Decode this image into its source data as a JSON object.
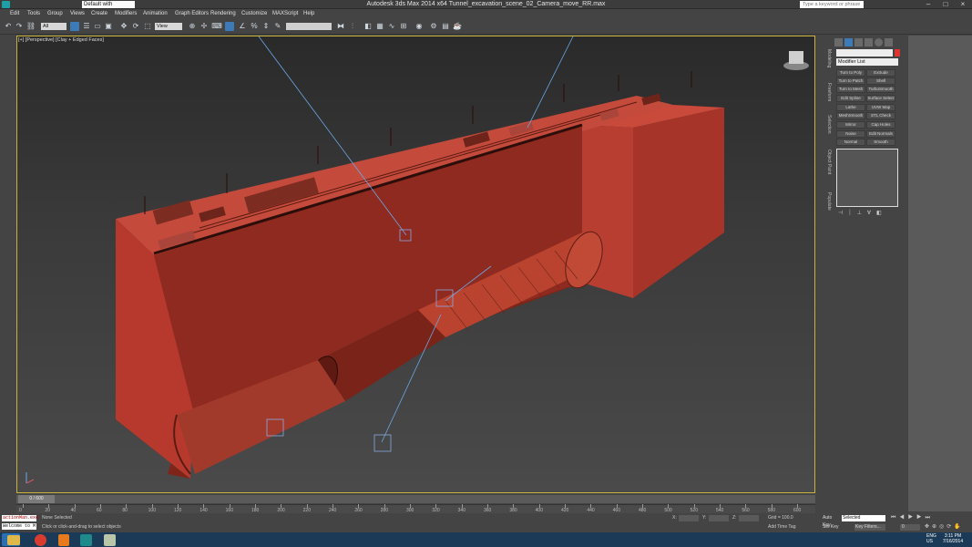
{
  "titlebar": {
    "workspace": "Default with Enhance",
    "title": "Autodesk 3ds Max  2014 x64     Tunnel_excavation_scene_02_Camera_move_RR.max",
    "search_placeholder": "Type a keyword or phrase"
  },
  "menu": [
    "Edit",
    "Tools",
    "Group",
    "Views",
    "Create",
    "Modifiers",
    "Animation",
    "Graph Editors",
    "Rendering",
    "Customize",
    "MAXScript",
    "Help"
  ],
  "toolbar": {
    "selection_filter": "All",
    "ref_coord": "View"
  },
  "viewport": {
    "label": "[+] [Perspective] [Clay + Edged Faces]"
  },
  "command_panel": {
    "tabs": [
      "Modeling",
      "Freeform",
      "Selection",
      "Object Paint",
      "Populate"
    ],
    "modifier_list": "Modifier List",
    "buttons": [
      [
        "Turn to Poly",
        "Extrude"
      ],
      [
        "Turn to Patch",
        "Shell"
      ],
      [
        "Turn to Mesh",
        "TurboSmooth"
      ],
      [
        "Edit Spline",
        "Surface Select"
      ],
      [
        "Lathe",
        "UVW Map"
      ],
      [
        "MeshSmooth",
        "STL Check"
      ],
      [
        "Mirror",
        "Cap Holes"
      ],
      [
        "Noise",
        "Edit Normals"
      ],
      [
        "Normal",
        "Smooth"
      ]
    ]
  },
  "timeline": {
    "frame": "0 / 600",
    "ticks": [
      "0",
      "20",
      "40",
      "60",
      "80",
      "100",
      "120",
      "140",
      "160",
      "180",
      "200",
      "220",
      "240",
      "260",
      "280",
      "300",
      "320",
      "340",
      "360",
      "380",
      "400",
      "420",
      "440",
      "460",
      "480",
      "500",
      "520",
      "540",
      "560",
      "580",
      "600"
    ]
  },
  "status": {
    "maxscript_1": "actionMan.exe",
    "maxscript_2": "Welcome to M",
    "selection": "None Selected",
    "prompt": "Click or click-and-drag to select objects",
    "x_label": "X:",
    "y_label": "Y:",
    "z_label": "Z:",
    "grid": "Grid = 100.0",
    "add_time_tag": "Add Time Tag",
    "auto_key": "Auto Key",
    "set_key": "Set Key",
    "selected": "Selected",
    "key_filters": "Key Filters...",
    "current_frame": "0"
  },
  "taskbar": {
    "lang": "ENG\nUS",
    "time": "3:11 PM",
    "date": "7/16/2014"
  },
  "colors": {
    "tunnel": "#b53a2e",
    "tunnel_dark": "#7e2319",
    "viewport_border": "#c8b23c",
    "taskbar": "#1b3a57"
  }
}
